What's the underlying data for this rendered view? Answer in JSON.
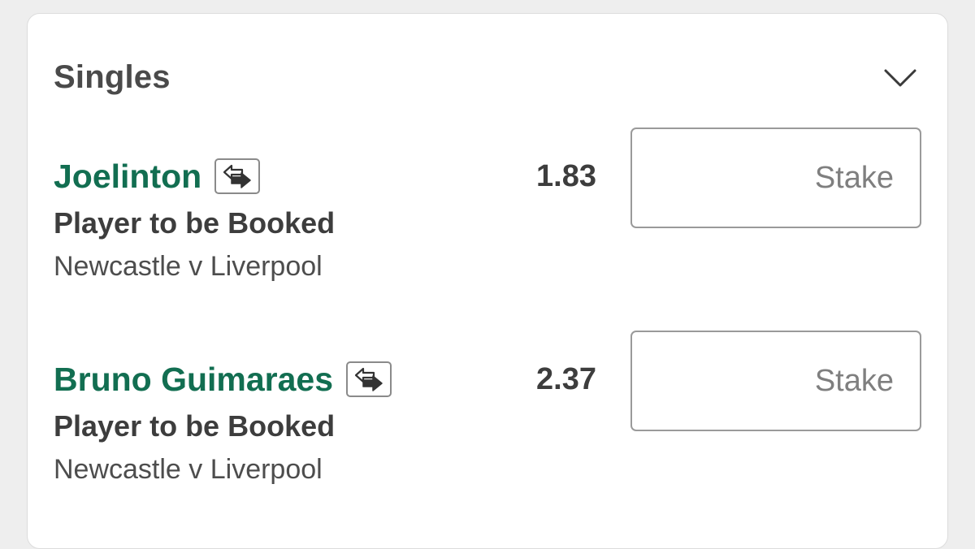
{
  "betslip": {
    "section_title": "Singles",
    "collapse_icon": "chevron-down-icon",
    "bets": [
      {
        "selection": "Joelinton",
        "market": "Player to be Booked",
        "event": "Newcastle v Liverpool",
        "odds": "1.83",
        "stake_placeholder": "Stake",
        "stake_value": "",
        "swap_icon": "swap-arrows-icon"
      },
      {
        "selection": "Bruno Guimaraes",
        "market": "Player to be Booked",
        "event": "Newcastle v Liverpool",
        "odds": "2.37",
        "stake_placeholder": "Stake",
        "stake_value": "",
        "swap_icon": "swap-arrows-icon"
      }
    ]
  },
  "colors": {
    "selection_green": "#126e51",
    "text_dark": "#3d3d3d",
    "page_background": "#eeeeee",
    "card_background": "#ffffff"
  }
}
